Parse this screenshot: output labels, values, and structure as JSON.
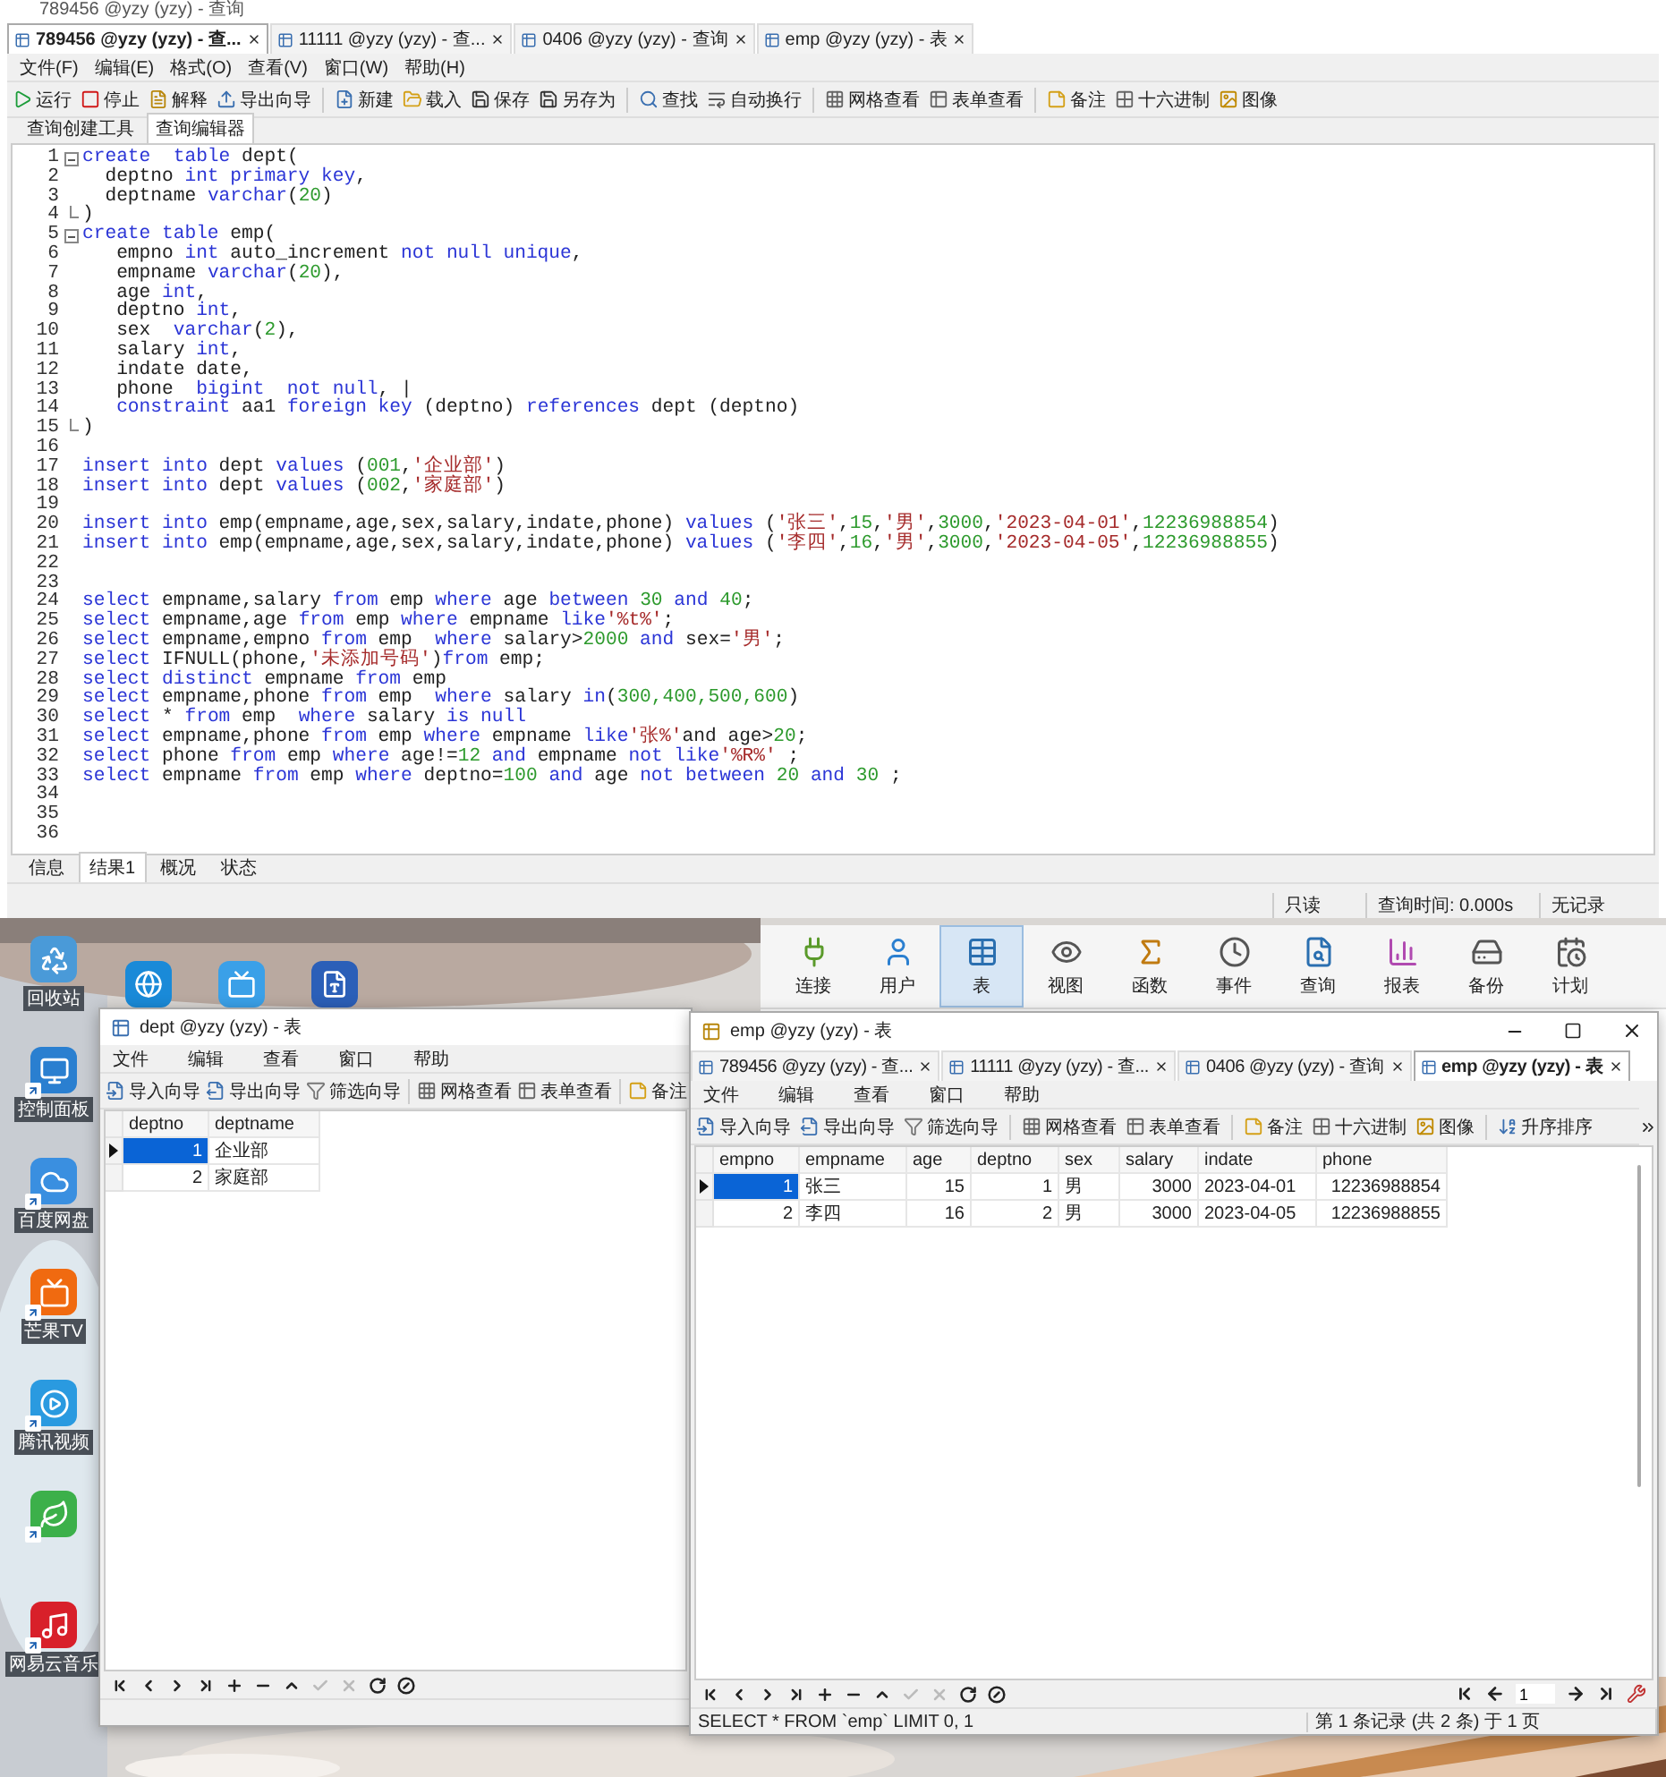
{
  "main_window": {
    "title": "789456 @yzy (yzy) - 查询",
    "tabs": [
      {
        "label": "789456 @yzy (yzy) - 查...",
        "selected": true
      },
      {
        "label": "11111 @yzy (yzy) - 查...",
        "selected": false
      },
      {
        "label": "0406 @yzy (yzy) - 查询",
        "selected": false
      },
      {
        "label": "emp @yzy (yzy) - 表",
        "selected": false
      }
    ],
    "menu": [
      "文件(F)",
      "编辑(E)",
      "格式(O)",
      "查看(V)",
      "窗口(W)",
      "帮助(H)"
    ],
    "toolbar": [
      [
        "运行",
        "停止",
        "解释",
        "导出向导"
      ],
      [
        "新建",
        "载入",
        "保存",
        "另存为"
      ],
      [
        "查找",
        "自动换行"
      ],
      [
        "网格查看",
        "表单查看"
      ],
      [
        "备注",
        "十六进制",
        "图像"
      ]
    ],
    "editor_tabs": [
      {
        "label": "查询创建工具",
        "selected": false
      },
      {
        "label": "查询编辑器",
        "selected": true
      }
    ],
    "code_lines": [
      {
        "n": "1",
        "fold_start": true,
        "segments": [
          {
            "kind": "kw",
            "text": "create  table"
          },
          {
            "kind": "plain",
            "text": " dept("
          }
        ]
      },
      {
        "n": "2",
        "segments": [
          {
            "kind": "plain",
            "text": "  deptno "
          },
          {
            "kind": "kw",
            "text": "int primary key"
          },
          {
            "kind": "plain",
            "text": ","
          }
        ]
      },
      {
        "n": "3",
        "segments": [
          {
            "kind": "plain",
            "text": "  deptname "
          },
          {
            "kind": "kw",
            "text": "varchar"
          },
          {
            "kind": "plain",
            "text": "("
          },
          {
            "kind": "num",
            "text": "20"
          },
          {
            "kind": "plain",
            "text": ")"
          }
        ]
      },
      {
        "n": "4",
        "fold_end": true,
        "segments": [
          {
            "kind": "plain",
            "text": ")"
          }
        ]
      },
      {
        "n": "5",
        "fold_start": true,
        "segments": [
          {
            "kind": "kw",
            "text": "create table"
          },
          {
            "kind": "plain",
            "text": " emp("
          }
        ]
      },
      {
        "n": "6",
        "segments": [
          {
            "kind": "plain",
            "text": "   empno "
          },
          {
            "kind": "kw",
            "text": "int"
          },
          {
            "kind": "plain",
            "text": " auto_increment "
          },
          {
            "kind": "kw",
            "text": "not null unique"
          },
          {
            "kind": "plain",
            "text": ","
          }
        ]
      },
      {
        "n": "7",
        "segments": [
          {
            "kind": "plain",
            "text": "   empname "
          },
          {
            "kind": "kw",
            "text": "varchar"
          },
          {
            "kind": "plain",
            "text": "("
          },
          {
            "kind": "num",
            "text": "20"
          },
          {
            "kind": "plain",
            "text": "),"
          }
        ]
      },
      {
        "n": "8",
        "segments": [
          {
            "kind": "plain",
            "text": "   age "
          },
          {
            "kind": "kw",
            "text": "int"
          },
          {
            "kind": "plain",
            "text": ","
          }
        ]
      },
      {
        "n": "9",
        "segments": [
          {
            "kind": "plain",
            "text": "   deptno "
          },
          {
            "kind": "kw",
            "text": "int"
          },
          {
            "kind": "plain",
            "text": ","
          }
        ]
      },
      {
        "n": "10",
        "segments": [
          {
            "kind": "plain",
            "text": "   sex  "
          },
          {
            "kind": "kw",
            "text": "varchar"
          },
          {
            "kind": "plain",
            "text": "("
          },
          {
            "kind": "num",
            "text": "2"
          },
          {
            "kind": "plain",
            "text": "),"
          }
        ]
      },
      {
        "n": "11",
        "segments": [
          {
            "kind": "plain",
            "text": "   salary "
          },
          {
            "kind": "kw",
            "text": "int"
          },
          {
            "kind": "plain",
            "text": ","
          }
        ]
      },
      {
        "n": "12",
        "segments": [
          {
            "kind": "plain",
            "text": "   indate date,"
          }
        ]
      },
      {
        "n": "13",
        "segments": [
          {
            "kind": "plain",
            "text": "   phone  "
          },
          {
            "kind": "kw",
            "text": "bigint  not null"
          },
          {
            "kind": "plain",
            "text": ", |"
          }
        ]
      },
      {
        "n": "14",
        "segments": [
          {
            "kind": "kw",
            "text": "   constraint"
          },
          {
            "kind": "plain",
            "text": " aa1 "
          },
          {
            "kind": "kw",
            "text": "foreign key"
          },
          {
            "kind": "plain",
            "text": " (deptno) "
          },
          {
            "kind": "kw",
            "text": "references"
          },
          {
            "kind": "plain",
            "text": " dept (deptno)"
          }
        ]
      },
      {
        "n": "15",
        "fold_end": true,
        "segments": [
          {
            "kind": "plain",
            "text": ")"
          }
        ]
      },
      {
        "n": "16"
      },
      {
        "n": "17",
        "segments": [
          {
            "kind": "kw",
            "text": "insert into"
          },
          {
            "kind": "plain",
            "text": " dept "
          },
          {
            "kind": "kw",
            "text": "values"
          },
          {
            "kind": "plain",
            "text": " ("
          },
          {
            "kind": "num",
            "text": "001"
          },
          {
            "kind": "plain",
            "text": ","
          },
          {
            "kind": "str",
            "text": "'企业部'"
          },
          {
            "kind": "plain",
            "text": ")"
          }
        ]
      },
      {
        "n": "18",
        "segments": [
          {
            "kind": "kw",
            "text": "insert into"
          },
          {
            "kind": "plain",
            "text": " dept "
          },
          {
            "kind": "kw",
            "text": "values"
          },
          {
            "kind": "plain",
            "text": " ("
          },
          {
            "kind": "num",
            "text": "002"
          },
          {
            "kind": "plain",
            "text": ","
          },
          {
            "kind": "str",
            "text": "'家庭部'"
          },
          {
            "kind": "plain",
            "text": ")"
          }
        ]
      },
      {
        "n": "19"
      },
      {
        "n": "20",
        "segments": [
          {
            "kind": "kw",
            "text": "insert into"
          },
          {
            "kind": "plain",
            "text": " emp(empname,age,sex,salary,indate,phone) "
          },
          {
            "kind": "kw",
            "text": "values"
          },
          {
            "kind": "plain",
            "text": " ("
          },
          {
            "kind": "str",
            "text": "'张三'"
          },
          {
            "kind": "plain",
            "text": ","
          },
          {
            "kind": "num",
            "text": "15"
          },
          {
            "kind": "plain",
            "text": ","
          },
          {
            "kind": "str",
            "text": "'男'"
          },
          {
            "kind": "plain",
            "text": ","
          },
          {
            "kind": "num",
            "text": "3000"
          },
          {
            "kind": "plain",
            "text": ","
          },
          {
            "kind": "str",
            "text": "'2023-04-01'"
          },
          {
            "kind": "plain",
            "text": ","
          },
          {
            "kind": "num",
            "text": "12236988854"
          },
          {
            "kind": "plain",
            "text": ")"
          }
        ]
      },
      {
        "n": "21",
        "segments": [
          {
            "kind": "kw",
            "text": "insert into"
          },
          {
            "kind": "plain",
            "text": " emp(empname,age,sex,salary,indate,phone) "
          },
          {
            "kind": "kw",
            "text": "values"
          },
          {
            "kind": "plain",
            "text": " ("
          },
          {
            "kind": "str",
            "text": "'李四'"
          },
          {
            "kind": "plain",
            "text": ","
          },
          {
            "kind": "num",
            "text": "16"
          },
          {
            "kind": "plain",
            "text": ","
          },
          {
            "kind": "str",
            "text": "'男'"
          },
          {
            "kind": "plain",
            "text": ","
          },
          {
            "kind": "num",
            "text": "3000"
          },
          {
            "kind": "plain",
            "text": ","
          },
          {
            "kind": "str",
            "text": "'2023-04-05'"
          },
          {
            "kind": "plain",
            "text": ","
          },
          {
            "kind": "num",
            "text": "12236988855"
          },
          {
            "kind": "plain",
            "text": ")"
          }
        ]
      },
      {
        "n": "22"
      },
      {
        "n": "23"
      },
      {
        "n": "24",
        "segments": [
          {
            "kind": "kw",
            "text": "select"
          },
          {
            "kind": "plain",
            "text": " empname,salary "
          },
          {
            "kind": "kw",
            "text": "from"
          },
          {
            "kind": "plain",
            "text": " emp "
          },
          {
            "kind": "kw",
            "text": "where"
          },
          {
            "kind": "plain",
            "text": " age "
          },
          {
            "kind": "kw",
            "text": "between"
          },
          {
            "kind": "num",
            "text": " 30"
          },
          {
            "kind": "kw",
            "text": " and"
          },
          {
            "kind": "num",
            "text": " 40"
          },
          {
            "kind": "plain",
            "text": ";"
          }
        ]
      },
      {
        "n": "25",
        "segments": [
          {
            "kind": "kw",
            "text": "select"
          },
          {
            "kind": "plain",
            "text": " empname,age "
          },
          {
            "kind": "kw",
            "text": "from"
          },
          {
            "kind": "plain",
            "text": " emp "
          },
          {
            "kind": "kw",
            "text": "where"
          },
          {
            "kind": "plain",
            "text": " empname "
          },
          {
            "kind": "kw",
            "text": "like"
          },
          {
            "kind": "str",
            "text": "'%t%'"
          },
          {
            "kind": "plain",
            "text": ";"
          }
        ]
      },
      {
        "n": "26",
        "segments": [
          {
            "kind": "kw",
            "text": "select"
          },
          {
            "kind": "plain",
            "text": " empname,empno "
          },
          {
            "kind": "kw",
            "text": "from"
          },
          {
            "kind": "plain",
            "text": " emp  "
          },
          {
            "kind": "kw",
            "text": "where"
          },
          {
            "kind": "plain",
            "text": " salary>"
          },
          {
            "kind": "num",
            "text": "2000"
          },
          {
            "kind": "kw",
            "text": " and"
          },
          {
            "kind": "plain",
            "text": " sex="
          },
          {
            "kind": "str",
            "text": "'男'"
          },
          {
            "kind": "plain",
            "text": ";"
          }
        ]
      },
      {
        "n": "27",
        "segments": [
          {
            "kind": "kw",
            "text": "select"
          },
          {
            "kind": "plain",
            "text": " IFNULL(phone,"
          },
          {
            "kind": "str",
            "text": "'未添加号码'"
          },
          {
            "kind": "plain",
            "text": ")"
          },
          {
            "kind": "kw",
            "text": "from"
          },
          {
            "kind": "plain",
            "text": " emp;"
          }
        ]
      },
      {
        "n": "28",
        "segments": [
          {
            "kind": "kw",
            "text": "select distinct"
          },
          {
            "kind": "plain",
            "text": " empname "
          },
          {
            "kind": "kw",
            "text": "from"
          },
          {
            "kind": "plain",
            "text": " emp"
          }
        ]
      },
      {
        "n": "29",
        "segments": [
          {
            "kind": "kw",
            "text": "select"
          },
          {
            "kind": "plain",
            "text": " empname,phone "
          },
          {
            "kind": "kw",
            "text": "from"
          },
          {
            "kind": "plain",
            "text": " emp  "
          },
          {
            "kind": "kw",
            "text": "where"
          },
          {
            "kind": "plain",
            "text": " salary "
          },
          {
            "kind": "kw",
            "text": "in"
          },
          {
            "kind": "plain",
            "text": "("
          },
          {
            "kind": "num",
            "text": "300,400,500,600"
          },
          {
            "kind": "plain",
            "text": ")"
          }
        ]
      },
      {
        "n": "30",
        "segments": [
          {
            "kind": "kw",
            "text": "select"
          },
          {
            "kind": "plain",
            "text": " * "
          },
          {
            "kind": "kw",
            "text": "from"
          },
          {
            "kind": "plain",
            "text": " emp  "
          },
          {
            "kind": "kw",
            "text": "where"
          },
          {
            "kind": "plain",
            "text": " salary "
          },
          {
            "kind": "kw",
            "text": "is null"
          }
        ]
      },
      {
        "n": "31",
        "segments": [
          {
            "kind": "kw",
            "text": "select"
          },
          {
            "kind": "plain",
            "text": " empname,phone "
          },
          {
            "kind": "kw",
            "text": "from"
          },
          {
            "kind": "plain",
            "text": " emp "
          },
          {
            "kind": "kw",
            "text": "where"
          },
          {
            "kind": "plain",
            "text": " empname "
          },
          {
            "kind": "kw",
            "text": "like"
          },
          {
            "kind": "str",
            "text": "'张%'"
          },
          {
            "kind": "plain",
            "text": "and age>"
          },
          {
            "kind": "num",
            "text": "20"
          },
          {
            "kind": "plain",
            "text": ";"
          }
        ]
      },
      {
        "n": "32",
        "segments": [
          {
            "kind": "kw",
            "text": "select"
          },
          {
            "kind": "plain",
            "text": " phone "
          },
          {
            "kind": "kw",
            "text": "from"
          },
          {
            "kind": "plain",
            "text": " emp "
          },
          {
            "kind": "kw",
            "text": "where"
          },
          {
            "kind": "plain",
            "text": " age!="
          },
          {
            "kind": "num",
            "text": "12"
          },
          {
            "kind": "kw",
            "text": " and"
          },
          {
            "kind": "plain",
            "text": " empname "
          },
          {
            "kind": "kw",
            "text": "not like"
          },
          {
            "kind": "str",
            "text": "'%R%'"
          },
          {
            "kind": "plain",
            "text": " ;"
          }
        ]
      },
      {
        "n": "33",
        "segments": [
          {
            "kind": "kw",
            "text": "select"
          },
          {
            "kind": "plain",
            "text": " empname "
          },
          {
            "kind": "kw",
            "text": "from"
          },
          {
            "kind": "plain",
            "text": " emp "
          },
          {
            "kind": "kw",
            "text": "where"
          },
          {
            "kind": "plain",
            "text": " deptno="
          },
          {
            "kind": "num",
            "text": "100"
          },
          {
            "kind": "kw",
            "text": " and"
          },
          {
            "kind": "plain",
            "text": " age "
          },
          {
            "kind": "kw",
            "text": "not between"
          },
          {
            "kind": "num",
            "text": " 20"
          },
          {
            "kind": "kw",
            "text": " and"
          },
          {
            "kind": "num",
            "text": " 30"
          },
          {
            "kind": "plain",
            "text": " ;"
          }
        ]
      },
      {
        "n": "34"
      },
      {
        "n": "35"
      },
      {
        "n": "36"
      }
    ],
    "result_tabs": [
      {
        "label": "信息",
        "selected": false
      },
      {
        "label": "结果1",
        "selected": true
      },
      {
        "label": "概况",
        "selected": false
      },
      {
        "label": "状态",
        "selected": false
      }
    ],
    "status_bar": [
      "只读",
      "查询时间: 0.000s",
      "无记录"
    ]
  },
  "desktop": {
    "icons": [
      {
        "kind": "system",
        "label": "回收站"
      },
      {
        "kind": "shortcut",
        "label": "控制面板"
      },
      {
        "kind": "shortcut",
        "label": "百度网盘"
      },
      {
        "kind": "shortcut",
        "label": "芒果TV"
      },
      {
        "kind": "shortcut",
        "label": "腾讯视频"
      },
      {
        "kind": "shortcut"
      },
      {
        "kind": "shortcut",
        "label": "网易云音乐"
      }
    ]
  },
  "back_window": {
    "ribbon": [
      {
        "label": "连接",
        "selected": false
      },
      {
        "label": "用户",
        "selected": false
      },
      {
        "label": "表",
        "selected": true
      },
      {
        "label": "视图",
        "selected": false
      },
      {
        "label": "函数",
        "selected": false
      },
      {
        "label": "事件",
        "selected": false
      },
      {
        "label": "查询",
        "selected": false
      },
      {
        "label": "报表",
        "selected": false
      },
      {
        "label": "备份",
        "selected": false
      },
      {
        "label": "计划",
        "selected": false
      }
    ]
  },
  "dept_window": {
    "title": "dept @yzy (yzy) - 表",
    "menu": [
      "文件",
      "编辑",
      "查看",
      "窗口",
      "帮助"
    ],
    "toolbar": [
      [
        "导入向导",
        "导出向导",
        "筛选向导"
      ],
      [
        "网格查看",
        "表单查看"
      ],
      [
        "备注"
      ]
    ],
    "table": {
      "columns": [
        {
          "label": "deptno",
          "numeric": true
        },
        {
          "label": "deptname",
          "numeric": false
        }
      ],
      "rows": [
        {
          "selected": true,
          "cells": [
            "1",
            "企业部"
          ]
        },
        {
          "selected": false,
          "cells": [
            "2",
            "家庭部"
          ]
        }
      ]
    }
  },
  "emp_window": {
    "title": "emp @yzy (yzy) - 表",
    "tabs": [
      {
        "label": "789456 @yzy (yzy) - 查...",
        "selected": false
      },
      {
        "label": "11111 @yzy (yzy) - 查...",
        "selected": false
      },
      {
        "label": "0406 @yzy (yzy) - 查询",
        "selected": false
      },
      {
        "label": "emp @yzy (yzy) - 表",
        "selected": true
      }
    ],
    "menu": [
      "文件",
      "编辑",
      "查看",
      "窗口",
      "帮助"
    ],
    "toolbar": [
      [
        "导入向导",
        "导出向导",
        "筛选向导"
      ],
      [
        "网格查看",
        "表单查看"
      ],
      [
        "备注",
        "十六进制",
        "图像"
      ],
      [
        "升序排序"
      ]
    ],
    "table": {
      "columns": [
        {
          "label": "empno",
          "numeric": true
        },
        {
          "label": "empname",
          "numeric": false
        },
        {
          "label": "age",
          "numeric": true
        },
        {
          "label": "deptno",
          "numeric": true
        },
        {
          "label": "sex",
          "numeric": false
        },
        {
          "label": "salary",
          "numeric": true
        },
        {
          "label": "indate",
          "numeric": false
        },
        {
          "label": "phone",
          "numeric": true
        }
      ],
      "rows": [
        {
          "selected": true,
          "cells": [
            "1",
            "张三",
            "15",
            "1",
            "男",
            "3000",
            "2023-04-01",
            "12236988854"
          ]
        },
        {
          "selected": false,
          "cells": [
            "2",
            "李四",
            "16",
            "2",
            "男",
            "3000",
            "2023-04-05",
            "12236988855"
          ]
        }
      ]
    },
    "page": "1",
    "sql": "SELECT * FROM `emp` LIMIT 0, 1",
    "record_info": "第 1 条记录 (共 2 条) 于 1 页"
  }
}
